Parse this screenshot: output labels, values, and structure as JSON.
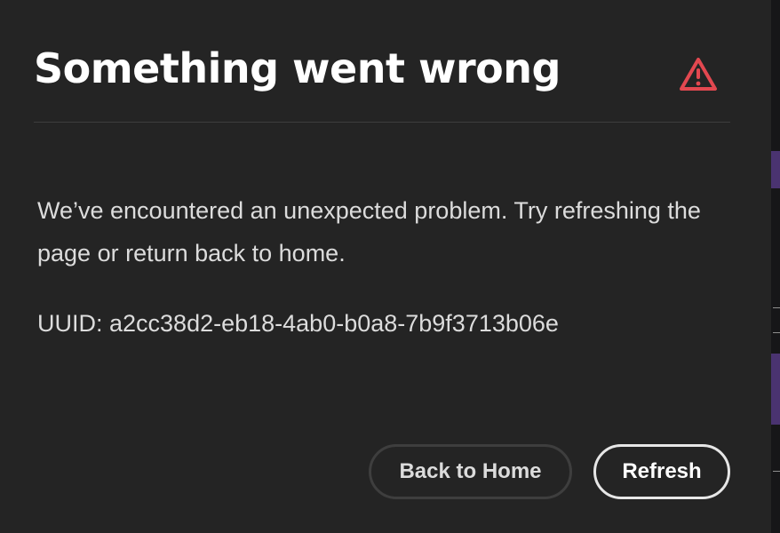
{
  "dialog": {
    "title": "Something went wrong",
    "alert_icon": "alert-triangle-icon",
    "alert_color": "#e34850",
    "message": "We’ve encountered an unexpected problem. Try refreshing the page or return back to home.",
    "uuid_text": "UUID: a2cc38d2-eb18-4ab0-b0a8-7b9f3713b06e"
  },
  "actions": {
    "back_home_label": "Back to Home",
    "refresh_label": "Refresh"
  },
  "colors": {
    "dialog_background": "#242424",
    "text_primary": "#ffffff",
    "text_secondary": "#dcdcdc",
    "backdrop_accent": "#4a3370"
  }
}
